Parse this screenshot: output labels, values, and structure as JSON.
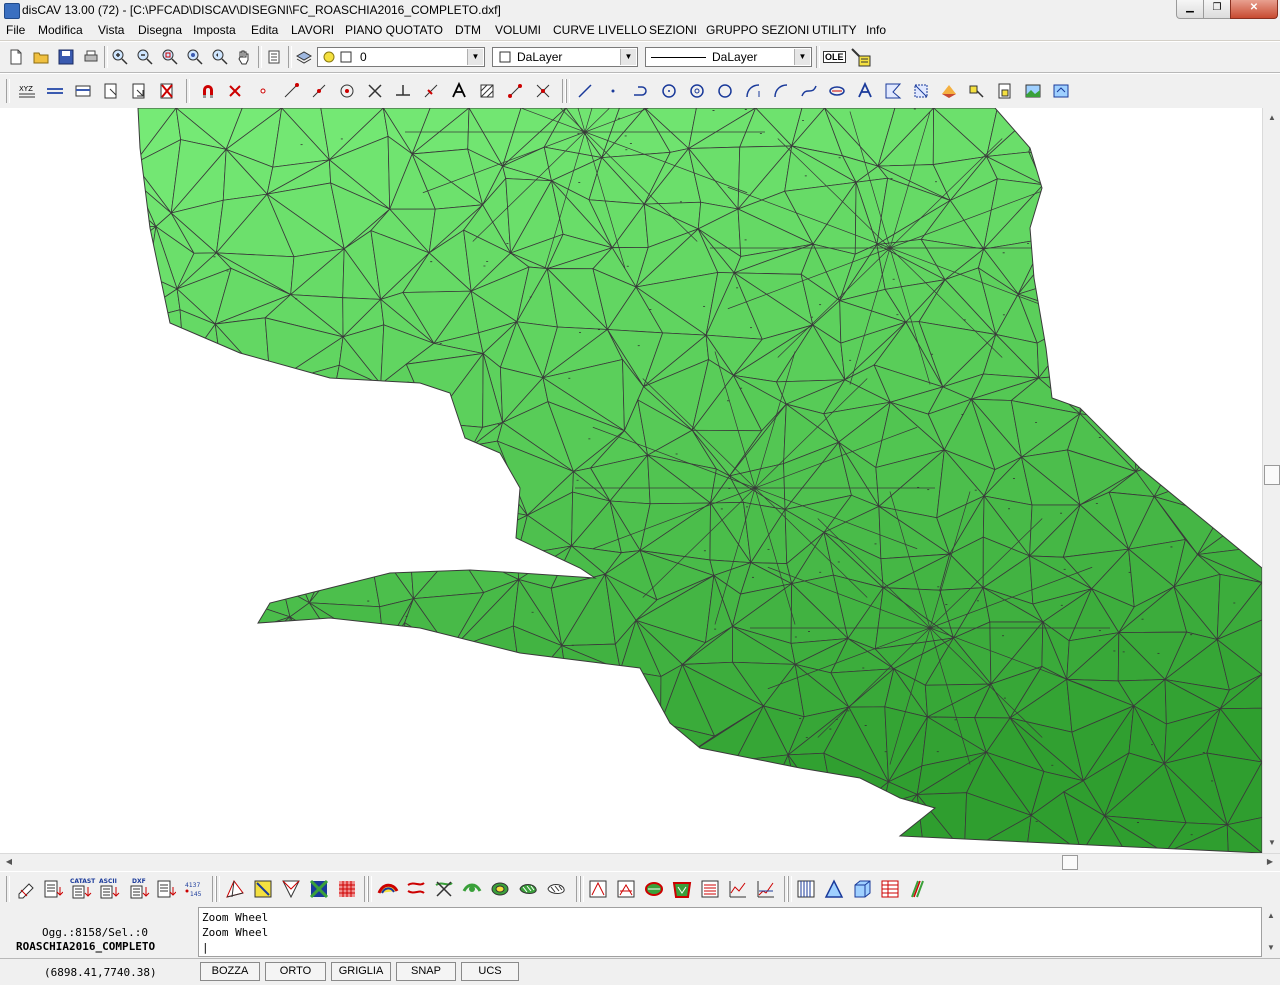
{
  "window": {
    "title": "disCAV 13.00 (72) - [C:\\PFCAD\\DISCAV\\DISEGNI\\FC_ROASCHIA2016_COMPLETO.dxf]",
    "minimize_glyph": "▁",
    "maximize_glyph": "❐",
    "close_glyph": "✕"
  },
  "menu": {
    "items": [
      "File",
      "Modifica",
      "Vista",
      "Disegna",
      "Imposta",
      "Edita",
      "LAVORI",
      "PIANO QUOTATO",
      "DTM",
      "VOLUMI",
      "CURVE LIVELLO",
      "SEZIONI",
      "GRUPPO SEZIONI",
      "UTILITY",
      "Info"
    ]
  },
  "toolbar": {
    "layer_value": "0",
    "color_value": "DaLayer",
    "linetype_value": "DaLayer",
    "ole_label": "OLE"
  },
  "toolbar_bottom": {
    "catast_label": "CATAST",
    "ascii_label": "ASCII",
    "dxf_label": "DXF"
  },
  "command": {
    "objects": "Ogg.:8158/Sel.:0",
    "drawing_name": "ROASCHIA2016_COMPLETO",
    "lines": [
      "Zoom Wheel",
      "Zoom Wheel"
    ],
    "prompt": "|"
  },
  "status": {
    "coords": "(6898.41,7740.38)",
    "bozza": "BOZZA",
    "orto": "ORTO",
    "griglia": "GRIGLIA",
    "snap": "SNAP",
    "ucs": "UCS"
  },
  "colors": {
    "tin_light": "#7aee7a",
    "tin_mid": "#58cc58",
    "tin_dark": "#2f9e2f",
    "edge": "#3a3a3a"
  }
}
